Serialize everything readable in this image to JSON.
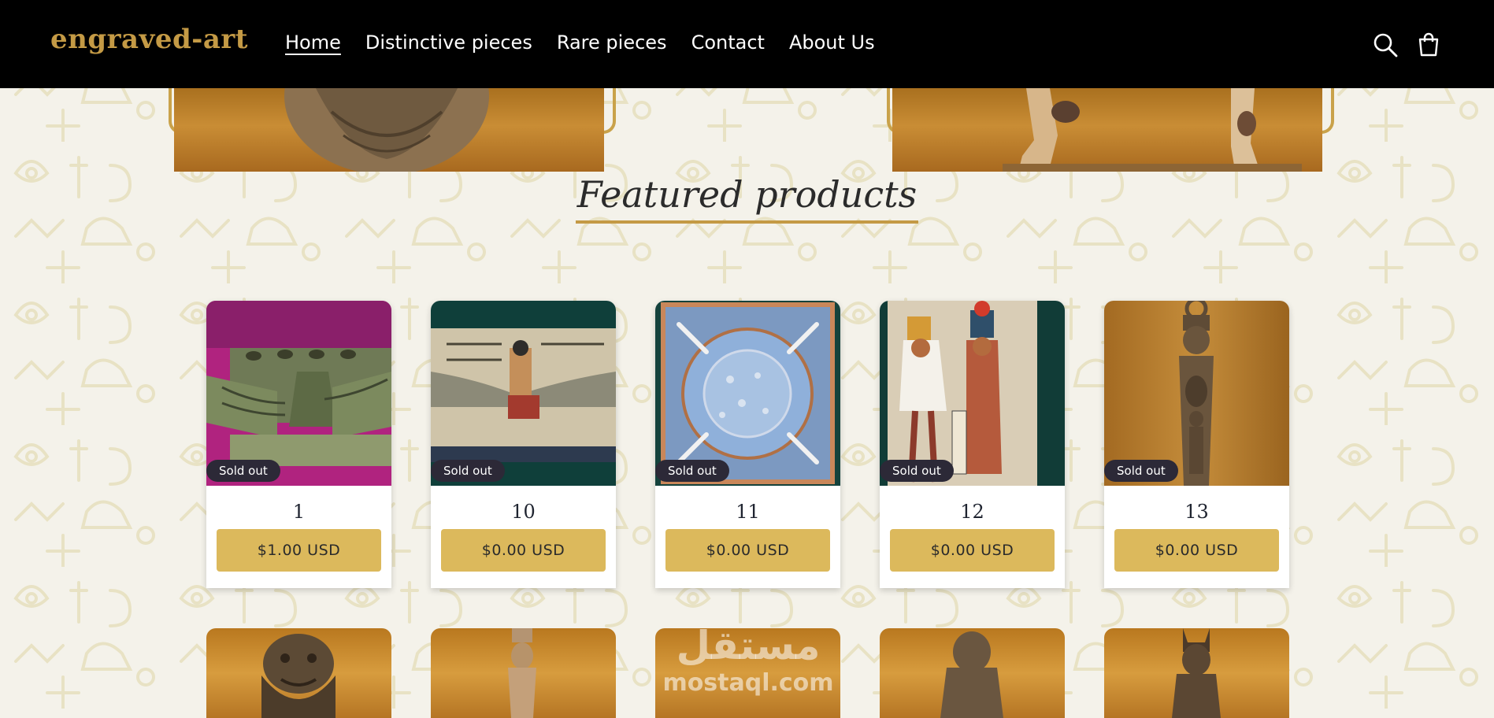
{
  "brand": {
    "logo": "engraved-art"
  },
  "nav": [
    {
      "label": "Home",
      "active": true
    },
    {
      "label": "Distinctive pieces",
      "active": false
    },
    {
      "label": "Rare pieces",
      "active": false
    },
    {
      "label": "Contact",
      "active": false
    },
    {
      "label": "About Us",
      "active": false
    }
  ],
  "header_icons": [
    "search-icon",
    "cart-icon"
  ],
  "featured": {
    "title": "Featured products",
    "products": [
      {
        "name": "1",
        "price": "$1.00 USD",
        "badge": "Sold out"
      },
      {
        "name": "10",
        "price": "$0.00 USD",
        "badge": "Sold out"
      },
      {
        "name": "11",
        "price": "$0.00 USD",
        "badge": "Sold out"
      },
      {
        "name": "12",
        "price": "$0.00 USD",
        "badge": "Sold out"
      },
      {
        "name": "13",
        "price": "$0.00 USD",
        "badge": "Sold out"
      }
    ]
  },
  "watermark": {
    "arabic": "مستقل",
    "latin": "mostaql.com"
  },
  "colors": {
    "header_bg": "#000000",
    "logo": "#c49a45",
    "accent_gold": "#dcb95c",
    "badge_bg": "#2c2937",
    "page_bg": "#f4f2ea"
  }
}
